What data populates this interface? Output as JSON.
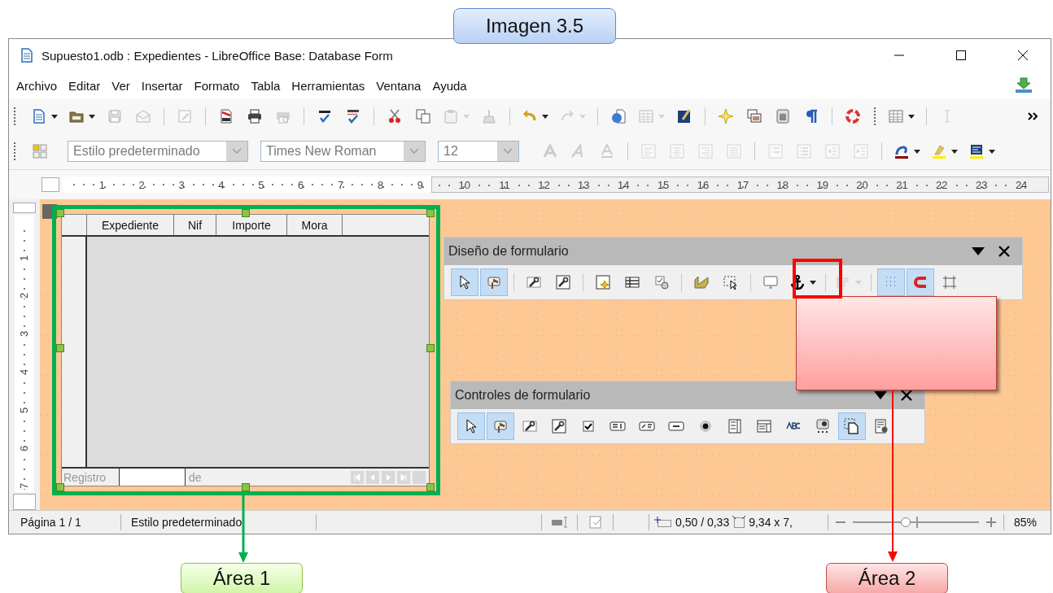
{
  "annotation": {
    "caption": "Imagen 3.5",
    "callouts": [
      {
        "label": "Área 1",
        "color": "#00b050"
      },
      {
        "label": "Área 2",
        "color": "#ff0000"
      }
    ]
  },
  "window": {
    "title": "Supuesto1.odb : Expedientes - LibreOffice Base: Database Form"
  },
  "menu": [
    "Archivo",
    "Editar",
    "Ver",
    "Insertar",
    "Formato",
    "Tabla",
    "Herramientas",
    "Ventana",
    "Ayuda"
  ],
  "standard_toolbar": [
    {
      "kind": "button",
      "disabled": false,
      "dropdown": true
    },
    {
      "kind": "button",
      "disabled": false,
      "dropdown": true
    },
    {
      "kind": "button",
      "disabled": true,
      "dropdown": false
    },
    {
      "kind": "button",
      "disabled": true,
      "dropdown": false
    },
    {
      "kind": "separator"
    },
    {
      "kind": "button",
      "disabled": true,
      "dropdown": false
    },
    {
      "kind": "separator"
    },
    {
      "kind": "button",
      "disabled": false,
      "dropdown": false
    },
    {
      "kind": "button",
      "disabled": false,
      "dropdown": false
    },
    {
      "kind": "button",
      "disabled": true,
      "dropdown": false
    },
    {
      "kind": "separator"
    },
    {
      "kind": "button",
      "disabled": false,
      "dropdown": false
    },
    {
      "kind": "button",
      "disabled": false,
      "dropdown": false
    },
    {
      "kind": "separator"
    },
    {
      "kind": "button",
      "disabled": false,
      "dropdown": false
    },
    {
      "kind": "button",
      "disabled": false,
      "dropdown": false
    },
    {
      "kind": "button",
      "disabled": true,
      "dropdown": true
    },
    {
      "kind": "button",
      "disabled": true,
      "dropdown": false
    },
    {
      "kind": "separator"
    },
    {
      "kind": "button",
      "disabled": false,
      "dropdown": true
    },
    {
      "kind": "button",
      "disabled": true,
      "dropdown": true
    },
    {
      "kind": "separator"
    },
    {
      "kind": "button",
      "disabled": false,
      "dropdown": false
    },
    {
      "kind": "button",
      "disabled": true,
      "dropdown": true
    },
    {
      "kind": "button",
      "disabled": false,
      "dropdown": false
    },
    {
      "kind": "separator"
    },
    {
      "kind": "button",
      "disabled": false,
      "dropdown": false
    },
    {
      "kind": "button",
      "disabled": false,
      "dropdown": false
    },
    {
      "kind": "button",
      "disabled": false,
      "dropdown": false
    },
    {
      "kind": "button",
      "disabled": false,
      "dropdown": false
    },
    {
      "kind": "separator"
    },
    {
      "kind": "button",
      "disabled": false,
      "dropdown": false
    },
    {
      "kind": "grip"
    },
    {
      "kind": "button",
      "disabled": false,
      "dropdown": true
    },
    {
      "kind": "separator"
    },
    {
      "kind": "button",
      "disabled": true,
      "dropdown": false
    },
    {
      "kind": "button",
      "disabled": false,
      "dropdown": false
    }
  ],
  "formatting_toolbar": [
    {
      "kind": "button",
      "disabled": false,
      "dropdown": false
    },
    {
      "kind": "combo",
      "value": "Estilo predeterminado",
      "disabled": true
    },
    {
      "kind": "combo",
      "value": "Times New Roman",
      "disabled": true
    },
    {
      "kind": "combo",
      "value": "12",
      "disabled": true
    },
    {
      "kind": "button",
      "disabled": true,
      "dropdown": false
    },
    {
      "kind": "button",
      "disabled": true,
      "dropdown": false
    },
    {
      "kind": "button",
      "disabled": true,
      "dropdown": false
    },
    {
      "kind": "separator"
    },
    {
      "kind": "button",
      "disabled": true,
      "dropdown": false
    },
    {
      "kind": "button",
      "disabled": true,
      "dropdown": false
    },
    {
      "kind": "button",
      "disabled": true,
      "dropdown": false
    },
    {
      "kind": "button",
      "disabled": true,
      "dropdown": false
    },
    {
      "kind": "separator"
    },
    {
      "kind": "button",
      "disabled": true,
      "dropdown": false
    },
    {
      "kind": "button",
      "disabled": true,
      "dropdown": false
    },
    {
      "kind": "button",
      "disabled": true,
      "dropdown": false
    },
    {
      "kind": "button",
      "disabled": true,
      "dropdown": false
    },
    {
      "kind": "separator"
    },
    {
      "kind": "button",
      "disabled": false,
      "dropdown": true
    },
    {
      "kind": "button",
      "disabled": false,
      "dropdown": true
    },
    {
      "kind": "button",
      "disabled": false,
      "dropdown": true
    }
  ],
  "horizontal_ruler": [
    "1",
    "2",
    "3",
    "4",
    "5",
    "6",
    "7",
    "8",
    "9",
    "10",
    "11",
    "12",
    "13",
    "14",
    "15",
    "16",
    "17",
    "18",
    "19",
    "20",
    "21",
    "22",
    "23",
    "24"
  ],
  "vertical_ruler": [
    "1",
    "2",
    "3",
    "4",
    "5",
    "6",
    "7"
  ],
  "form_grid": {
    "columns": [
      "Expediente",
      "Nif",
      "Importe",
      "Mora"
    ],
    "record_label": "Registro",
    "of_label": "de"
  },
  "floating_toolbars": [
    {
      "title": "Diseño de formulario",
      "items": [
        {
          "kind": "button",
          "selected": true,
          "disabled": false,
          "dropdown": false
        },
        {
          "kind": "button",
          "selected": true,
          "disabled": false,
          "dropdown": false
        },
        {
          "kind": "separator"
        },
        {
          "kind": "button",
          "selected": false,
          "disabled": false,
          "dropdown": false
        },
        {
          "kind": "button",
          "selected": false,
          "disabled": false,
          "dropdown": false
        },
        {
          "kind": "separator"
        },
        {
          "kind": "button",
          "selected": false,
          "disabled": false,
          "dropdown": false
        },
        {
          "kind": "button",
          "selected": false,
          "disabled": false,
          "dropdown": false
        },
        {
          "kind": "button",
          "selected": false,
          "disabled": false,
          "dropdown": false
        },
        {
          "kind": "separator"
        },
        {
          "kind": "button",
          "selected": false,
          "disabled": false,
          "dropdown": false
        },
        {
          "kind": "button",
          "selected": false,
          "disabled": false,
          "dropdown": false
        },
        {
          "kind": "separator"
        },
        {
          "kind": "button",
          "selected": false,
          "disabled": false,
          "dropdown": false
        },
        {
          "kind": "button",
          "selected": false,
          "disabled": false,
          "dropdown": true
        },
        {
          "kind": "separator"
        },
        {
          "kind": "button",
          "selected": false,
          "disabled": true,
          "dropdown": true
        },
        {
          "kind": "separator"
        },
        {
          "kind": "button",
          "selected": true,
          "disabled": false,
          "dropdown": false
        },
        {
          "kind": "button",
          "selected": true,
          "disabled": false,
          "dropdown": false
        },
        {
          "kind": "button",
          "selected": false,
          "disabled": false,
          "dropdown": false
        }
      ]
    },
    {
      "title": "Controles de formulario",
      "items": [
        {
          "kind": "button",
          "selected": true,
          "disabled": false,
          "dropdown": false
        },
        {
          "kind": "button",
          "selected": true,
          "disabled": false,
          "dropdown": false
        },
        {
          "kind": "button",
          "selected": false,
          "disabled": false,
          "dropdown": false
        },
        {
          "kind": "button",
          "selected": false,
          "disabled": false,
          "dropdown": false
        },
        {
          "kind": "button",
          "selected": false,
          "disabled": false,
          "dropdown": false
        },
        {
          "kind": "button",
          "selected": false,
          "disabled": false,
          "dropdown": false
        },
        {
          "kind": "button",
          "selected": false,
          "disabled": false,
          "dropdown": false
        },
        {
          "kind": "button",
          "selected": false,
          "disabled": false,
          "dropdown": false
        },
        {
          "kind": "button",
          "selected": false,
          "disabled": false,
          "dropdown": false
        },
        {
          "kind": "button",
          "selected": false,
          "disabled": false,
          "dropdown": false
        },
        {
          "kind": "button",
          "selected": false,
          "disabled": false,
          "dropdown": false
        },
        {
          "kind": "button",
          "selected": false,
          "disabled": false,
          "dropdown": false
        },
        {
          "kind": "button",
          "selected": false,
          "disabled": false,
          "dropdown": false
        },
        {
          "kind": "button",
          "selected": true,
          "disabled": false,
          "dropdown": false
        },
        {
          "kind": "button",
          "selected": false,
          "disabled": false,
          "dropdown": false
        }
      ]
    }
  ],
  "status_bar": {
    "page": "Página 1 / 1",
    "style": "Estilo predeterminado",
    "position": "0,50 / 0,33",
    "size": "9,34 x 7,",
    "zoom": {
      "level": 0.42
    },
    "zoom_percent": "85%"
  }
}
